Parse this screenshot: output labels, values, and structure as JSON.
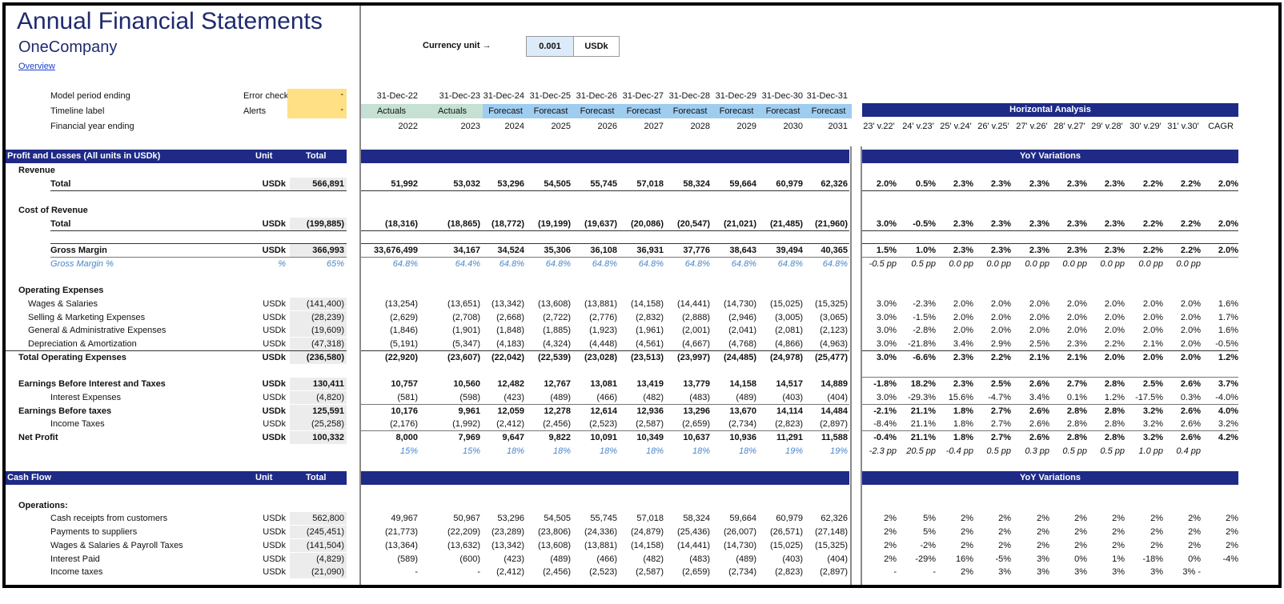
{
  "header": {
    "title": "Annual Financial Statements",
    "company": "OneCompany",
    "overview_link": "Overview"
  },
  "currency": {
    "label": "Currency unit →",
    "value": "0.001",
    "unit": "USDk"
  },
  "meta": {
    "model_period": "Model period ending",
    "timeline_label": "Timeline label",
    "fy_ending": "Financial year ending",
    "error_check": "Error check",
    "alerts": "Alerts",
    "error_val": "-",
    "alerts_val": "-"
  },
  "periods": [
    "31-Dec-22",
    "31-Dec-23",
    "31-Dec-24",
    "31-Dec-25",
    "31-Dec-26",
    "31-Dec-27",
    "31-Dec-28",
    "31-Dec-29",
    "31-Dec-30",
    "31-Dec-31"
  ],
  "timeline": [
    "Actuals",
    "Actuals",
    "Forecast",
    "Forecast",
    "Forecast",
    "Forecast",
    "Forecast",
    "Forecast",
    "Forecast",
    "Forecast"
  ],
  "years": [
    "2022",
    "2023",
    "2024",
    "2025",
    "2026",
    "2027",
    "2028",
    "2029",
    "2030",
    "2031"
  ],
  "ha": {
    "title": "Horizontal Analysis",
    "yoy": "YoY Variations",
    "cols": [
      "23' v.22'",
      "24' v.23'",
      "25' v.24'",
      "26' v.25'",
      "27' v.26'",
      "28' v.27'",
      "29' v.28'",
      "30' v.29'",
      "31' v.30'",
      "CAGR"
    ]
  },
  "colors": {
    "navy": "#1f2a87",
    "actuals": "#c6e0d4",
    "forecast": "#9fcdf0",
    "yellow": "#ffe084",
    "currency_box": "#dcebfa",
    "total_bg": "#ececec",
    "pct_blue": "#4a86c8"
  },
  "pl": {
    "header": "Profit and Losses (All units in USDk)",
    "unit_h": "Unit",
    "total_h": "Total",
    "rows": [
      {
        "label": "Revenue",
        "style": "section"
      },
      {
        "label": "Total",
        "style": "bold",
        "indent": 2,
        "unit": "USDk",
        "total": "566,891",
        "vals": [
          "51,992",
          "53,032",
          "53,296",
          "54,505",
          "55,745",
          "57,018",
          "58,324",
          "59,664",
          "60,979",
          "62,326"
        ],
        "ha": [
          "2.0%",
          "0.5%",
          "2.3%",
          "2.3%",
          "2.3%",
          "2.3%",
          "2.3%",
          "2.2%",
          "2.2%",
          "2.0%"
        ]
      },
      {
        "label": "",
        "style": "blank"
      },
      {
        "label": "Cost of Revenue",
        "style": "section"
      },
      {
        "label": "Total",
        "style": "bold",
        "indent": 2,
        "unit": "USDk",
        "total": "(199,885)",
        "vals": [
          "(18,316)",
          "(18,865)",
          "(18,772)",
          "(19,199)",
          "(19,637)",
          "(20,086)",
          "(20,547)",
          "(21,021)",
          "(21,485)",
          "(21,960)"
        ],
        "ha": [
          "3.0%",
          "-0.5%",
          "2.3%",
          "2.3%",
          "2.3%",
          "2.3%",
          "2.3%",
          "2.2%",
          "2.2%",
          "2.0%"
        ]
      },
      {
        "label": "",
        "style": "blank"
      },
      {
        "label": "Gross Margin",
        "style": "gm",
        "indent": 2,
        "unit": "USDk",
        "total": "366,993",
        "vals": [
          "33,676,499",
          "34,167",
          "34,524",
          "35,306",
          "36,108",
          "36,931",
          "37,776",
          "38,643",
          "39,494",
          "40,365"
        ],
        "ha": [
          "1.5%",
          "1.0%",
          "2.3%",
          "2.3%",
          "2.3%",
          "2.3%",
          "2.3%",
          "2.2%",
          "2.2%",
          "2.0%"
        ]
      },
      {
        "label": "Gross Margin %",
        "style": "pct",
        "indent": 2,
        "unit": "%",
        "total": "65%",
        "vals": [
          "64.8%",
          "64.4%",
          "64.8%",
          "64.8%",
          "64.8%",
          "64.8%",
          "64.8%",
          "64.8%",
          "64.8%",
          "64.8%"
        ],
        "ha": [
          "-0.5 pp",
          "0.5 pp",
          "0.0 pp",
          "0.0 pp",
          "0.0 pp",
          "0.0 pp",
          "0.0 pp",
          "0.0 pp",
          "0.0 pp",
          ""
        ]
      },
      {
        "label": "",
        "style": "blank"
      },
      {
        "label": "Operating Expenses",
        "style": "section"
      },
      {
        "label": "Wages & Salaries",
        "style": "normal",
        "indent": 1,
        "unit": "USDk",
        "total": "(141,400)",
        "vals": [
          "(13,254)",
          "(13,651)",
          "(13,342)",
          "(13,608)",
          "(13,881)",
          "(14,158)",
          "(14,441)",
          "(14,730)",
          "(15,025)",
          "(15,325)"
        ],
        "ha": [
          "3.0%",
          "-2.3%",
          "2.0%",
          "2.0%",
          "2.0%",
          "2.0%",
          "2.0%",
          "2.0%",
          "2.0%",
          "1.6%"
        ]
      },
      {
        "label": "Selling & Marketing Expenses",
        "style": "normal",
        "indent": 1,
        "unit": "USDk",
        "total": "(28,239)",
        "vals": [
          "(2,629)",
          "(2,708)",
          "(2,668)",
          "(2,722)",
          "(2,776)",
          "(2,832)",
          "(2,888)",
          "(2,946)",
          "(3,005)",
          "(3,065)"
        ],
        "ha": [
          "3.0%",
          "-1.5%",
          "2.0%",
          "2.0%",
          "2.0%",
          "2.0%",
          "2.0%",
          "2.0%",
          "2.0%",
          "1.7%"
        ]
      },
      {
        "label": "General & Administrative Expenses",
        "style": "normal",
        "indent": 1,
        "unit": "USDk",
        "total": "(19,609)",
        "vals": [
          "(1,846)",
          "(1,901)",
          "(1,848)",
          "(1,885)",
          "(1,923)",
          "(1,961)",
          "(2,001)",
          "(2,041)",
          "(2,081)",
          "(2,123)"
        ],
        "ha": [
          "3.0%",
          "-2.8%",
          "2.0%",
          "2.0%",
          "2.0%",
          "2.0%",
          "2.0%",
          "2.0%",
          "2.0%",
          "1.6%"
        ]
      },
      {
        "label": "Depreciation & Amortization",
        "style": "normal",
        "indent": 1,
        "unit": "USDk",
        "total": "(47,318)",
        "vals": [
          "(5,191)",
          "(5,347)",
          "(4,183)",
          "(4,324)",
          "(4,448)",
          "(4,561)",
          "(4,667)",
          "(4,768)",
          "(4,866)",
          "(4,963)"
        ],
        "ha": [
          "3.0%",
          "-21.8%",
          "3.4%",
          "2.9%",
          "2.5%",
          "2.3%",
          "2.2%",
          "2.1%",
          "2.0%",
          "-0.5%"
        ]
      },
      {
        "label": "Total Operating Expenses",
        "style": "totop",
        "indent": 0,
        "unit": "USDk",
        "total": "(236,580)",
        "vals": [
          "(22,920)",
          "(23,607)",
          "(22,042)",
          "(22,539)",
          "(23,028)",
          "(23,513)",
          "(23,997)",
          "(24,485)",
          "(24,978)",
          "(25,477)"
        ],
        "ha": [
          "3.0%",
          "-6.6%",
          "2.3%",
          "2.2%",
          "2.1%",
          "2.1%",
          "2.0%",
          "2.0%",
          "2.0%",
          "1.2%"
        ]
      },
      {
        "label": "",
        "style": "blank"
      },
      {
        "label": "Earnings Before Interest and Taxes",
        "style": "bold",
        "indent": 0,
        "unit": "USDk",
        "total": "130,411",
        "vals": [
          "10,757",
          "10,560",
          "12,482",
          "12,767",
          "13,081",
          "13,419",
          "13,779",
          "14,158",
          "14,517",
          "14,889"
        ],
        "ha": [
          "-1.8%",
          "18.2%",
          "2.3%",
          "2.5%",
          "2.6%",
          "2.7%",
          "2.8%",
          "2.5%",
          "2.6%",
          "3.7%"
        ]
      },
      {
        "label": "Interest Expenses",
        "style": "small",
        "indent": 2,
        "unit": "USDk",
        "total": "(4,820)",
        "vals": [
          "(581)",
          "(598)",
          "(423)",
          "(489)",
          "(466)",
          "(482)",
          "(483)",
          "(489)",
          "(403)",
          "(404)"
        ],
        "ha": [
          "3.0%",
          "-29.3%",
          "15.6%",
          "-4.7%",
          "3.4%",
          "0.1%",
          "1.2%",
          "-17.5%",
          "0.3%",
          "-4.0%"
        ]
      },
      {
        "label": "Earnings Before taxes",
        "style": "bold",
        "indent": 0,
        "unit": "USDk",
        "total": "125,591",
        "vals": [
          "10,176",
          "9,961",
          "12,059",
          "12,278",
          "12,614",
          "12,936",
          "13,296",
          "13,670",
          "14,114",
          "14,484"
        ],
        "ha": [
          "-2.1%",
          "21.1%",
          "1.8%",
          "2.7%",
          "2.6%",
          "2.8%",
          "2.8%",
          "3.2%",
          "2.6%",
          "4.0%"
        ]
      },
      {
        "label": "Income Taxes",
        "style": "small",
        "indent": 2,
        "unit": "USDk",
        "total": "(25,258)",
        "vals": [
          "(2,176)",
          "(1,992)",
          "(2,412)",
          "(2,456)",
          "(2,523)",
          "(2,587)",
          "(2,659)",
          "(2,734)",
          "(2,823)",
          "(2,897)"
        ],
        "ha": [
          "-8.4%",
          "21.1%",
          "1.8%",
          "2.7%",
          "2.6%",
          "2.8%",
          "2.8%",
          "3.2%",
          "2.6%",
          "3.2%"
        ]
      },
      {
        "label": "Net Profit",
        "style": "bold",
        "indent": 0,
        "unit": "USDk",
        "total": "100,332",
        "vals": [
          "8,000",
          "7,969",
          "9,647",
          "9,822",
          "10,091",
          "10,349",
          "10,637",
          "10,936",
          "11,291",
          "11,588"
        ],
        "ha": [
          "-0.4%",
          "21.1%",
          "1.8%",
          "2.7%",
          "2.6%",
          "2.8%",
          "2.8%",
          "3.2%",
          "2.6%",
          "4.2%"
        ]
      },
      {
        "label": "",
        "style": "pctnp",
        "indent": 0,
        "unit": "",
        "total": "",
        "vals": [
          "15%",
          "15%",
          "18%",
          "18%",
          "18%",
          "18%",
          "18%",
          "18%",
          "19%",
          "19%"
        ],
        "ha": [
          "-2.3 pp",
          "20.5 pp",
          "-0.4 pp",
          "0.5 pp",
          "0.3 pp",
          "0.5 pp",
          "0.5 pp",
          "1.0 pp",
          "0.4 pp",
          ""
        ]
      }
    ]
  },
  "cf": {
    "header": "Cash Flow",
    "unit_h": "Unit",
    "total_h": "Total",
    "rows": [
      {
        "label": "",
        "style": "blank"
      },
      {
        "label": "Operations:",
        "style": "section"
      },
      {
        "label": "Cash receipts from customers",
        "style": "small",
        "indent": 2,
        "unit": "USDk",
        "total": "562,800",
        "vals": [
          "49,967",
          "50,967",
          "53,296",
          "54,505",
          "55,745",
          "57,018",
          "58,324",
          "59,664",
          "60,979",
          "62,326"
        ],
        "ha": [
          "2%",
          "5%",
          "2%",
          "2%",
          "2%",
          "2%",
          "2%",
          "2%",
          "2%",
          "2%"
        ]
      },
      {
        "label": "Payments to suppliers",
        "style": "small",
        "indent": 2,
        "unit": "USDk",
        "total": "(245,451)",
        "vals": [
          "(21,773)",
          "(22,209)",
          "(23,289)",
          "(23,806)",
          "(24,336)",
          "(24,879)",
          "(25,436)",
          "(26,007)",
          "(26,571)",
          "(27,148)"
        ],
        "ha": [
          "2%",
          "5%",
          "2%",
          "2%",
          "2%",
          "2%",
          "2%",
          "2%",
          "2%",
          "2%"
        ]
      },
      {
        "label": "Wages & Salaries & Payroll Taxes",
        "style": "small",
        "indent": 2,
        "unit": "USDk",
        "total": "(141,504)",
        "vals": [
          "(13,364)",
          "(13,632)",
          "(13,342)",
          "(13,608)",
          "(13,881)",
          "(14,158)",
          "(14,441)",
          "(14,730)",
          "(15,025)",
          "(15,325)"
        ],
        "ha": [
          "2%",
          "-2%",
          "2%",
          "2%",
          "2%",
          "2%",
          "2%",
          "2%",
          "2%",
          "2%"
        ]
      },
      {
        "label": "Interest Paid",
        "style": "small",
        "indent": 2,
        "unit": "USDk",
        "total": "(4,829)",
        "vals": [
          "(589)",
          "(600)",
          "(423)",
          "(489)",
          "(466)",
          "(482)",
          "(483)",
          "(489)",
          "(403)",
          "(404)"
        ],
        "ha": [
          "2%",
          "-29%",
          "16%",
          "-5%",
          "3%",
          "0%",
          "1%",
          "-18%",
          "0%",
          "-4%"
        ]
      },
      {
        "label": "Income taxes",
        "style": "small",
        "indent": 2,
        "unit": "USDk",
        "total": "(21,090)",
        "vals": [
          "-",
          "-",
          "(2,412)",
          "(2,456)",
          "(2,523)",
          "(2,587)",
          "(2,659)",
          "(2,734)",
          "(2,823)",
          "(2,897)"
        ],
        "ha": [
          "-",
          "-",
          "2%",
          "3%",
          "3%",
          "3%",
          "3%",
          "3%",
          "3% -",
          ""
        ]
      }
    ]
  }
}
